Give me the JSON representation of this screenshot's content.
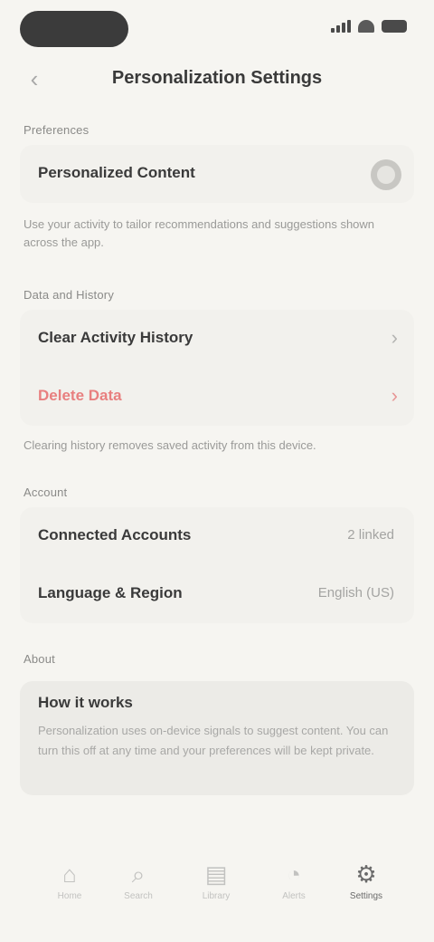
{
  "header": {
    "back_icon": "‹",
    "title": "Personalization Settings"
  },
  "sections": {
    "preferences": {
      "label": "Preferences",
      "row_label": "Personalized Content",
      "toggle_on": false,
      "helper": "Use your activity to tailor recommendations and suggestions shown across the app."
    },
    "data": {
      "label": "Data and History",
      "clear_label": "Clear Activity History",
      "delete_label": "Delete Data",
      "helper": "Clearing history removes saved activity from this device."
    },
    "account": {
      "label": "Account",
      "rows": [
        {
          "label": "Connected Accounts",
          "value": "2 linked"
        },
        {
          "label": "Language & Region",
          "value": "English (US)"
        }
      ]
    },
    "about": {
      "label": "About",
      "title": "How it works",
      "text": "Personalization uses on-device signals to suggest content. You can turn this off at any time and your preferences will be kept private."
    }
  },
  "tabbar": {
    "items": [
      {
        "label": "Home",
        "icon": "home-icon",
        "glyph": "⌂"
      },
      {
        "label": "Search",
        "icon": "search-icon",
        "glyph": "⌕"
      },
      {
        "label": "Library",
        "icon": "library-icon",
        "glyph": "▤"
      },
      {
        "label": "Alerts",
        "icon": "bell-icon",
        "glyph": "◔"
      },
      {
        "label": "Settings",
        "icon": "gear-icon",
        "glyph": "⚙"
      }
    ],
    "active_index": 4
  }
}
